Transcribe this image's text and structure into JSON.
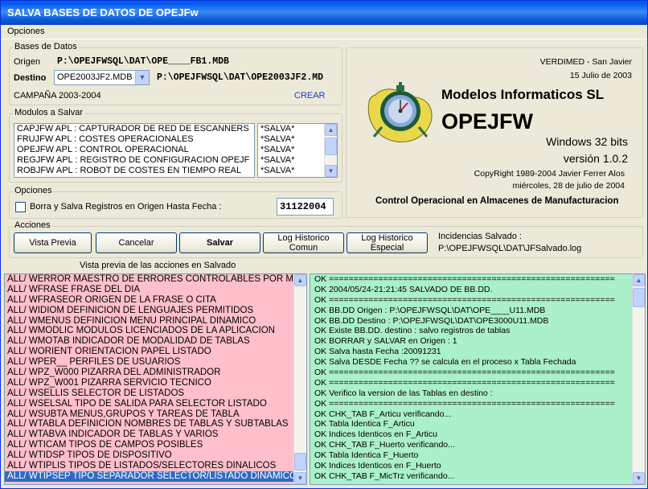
{
  "window": {
    "title": "SALVA BASES DE DATOS DE OPEJFw"
  },
  "menu": {
    "opciones": "Opciones"
  },
  "bases": {
    "label": "Bases de Datos",
    "origen_label": "Origen",
    "origen_path": "P:\\OPEJFWSQL\\DAT\\OPE____FB1.MDB",
    "destino_label": "Destino",
    "destino_combo": "OPE2003JF2.MDB",
    "destino_path": "P:\\OPEJFWSQL\\DAT\\OPE2003JF2.MD",
    "campana": "CAMPAÑA 2003-2004",
    "crear": "CREAR"
  },
  "modulos": {
    "label": "Modulos a Salvar",
    "items": [
      "CAPJFW APL : CAPTURADOR DE RED DE ESCANNERS",
      "FRUJFW APL : COSTES OPERACIONALES",
      "OPEJFW APL : CONTROL OPERACIONAL",
      "REGJFW APL : REGISTRO DE CONFIGURACION OPEJF",
      "ROBJFW APL : ROBOT DE COSTES EN TIEMPO REAL"
    ],
    "status": [
      "*SALVA*",
      "*SALVA*",
      "*SALVA*",
      "*SALVA*",
      "*SALVA*"
    ]
  },
  "opciones": {
    "label": "Opciones",
    "checkbox_label": "Borra y Salva Registros en Origen Hasta Fecha :",
    "fecha": "31122004"
  },
  "info": {
    "company_top": "VERDIMED - San Javier",
    "date_top": "15 Julio de 2003",
    "company": "Modelos Informaticos SL",
    "product": "OPEJFW",
    "platform": "Windows 32 bits",
    "version": "versión 1.0.2",
    "copyright": "CopyRight 1989-2004 Javier Ferrer Alos",
    "today": "miércoles, 28 de julio de 2004",
    "description": "Control Operacional en Almacenes de Manufacturacion"
  },
  "acciones": {
    "label": "Acciones",
    "buttons": {
      "vista_previa": "Vista Previa",
      "cancelar": "Cancelar",
      "salvar": "Salvar",
      "log_comun_1": "Log Historico",
      "log_comun_2": "Comun",
      "log_especial_1": "Log Historico",
      "log_especial_2": "Especial"
    },
    "incidencias_label": "Incidencias Salvado :",
    "incidencias_path": "P:\\OPEJFWSQL\\DAT\\JFSalvado.log"
  },
  "preview": {
    "caption": "Vista previa de las acciones en Salvado",
    "rows": [
      "ALL/ WERROR MAESTRO DE ERRORES CONTROLABLES POR MDB",
      "ALL/ WFRASE FRASE DEL DIA",
      "ALL/ WFRASEOR ORIGEN DE LA FRASE O CITA",
      "ALL/ WIDIOM DEFINICION DE LENGUAJES PERMITIDOS",
      "ALL/ WMENUS DEFINICION MENU PRINCIPAL DINAMICO",
      "ALL/ WMODLIC MODULOS LICENCIADOS DE LA APLICACION",
      "ALL/ WMOTAB INDICADOR DE MODALIDAD DE TABLAS",
      "ALL/ WORIENT ORIENTACION PAPEL LISTADO",
      "ALL/ WPER__ PERFILES DE USUARIOS",
      "ALL/ WPZ_W000 PIZARRA DEL ADMINISTRADOR",
      "ALL/ WPZ_W001 PIZARRA SERVICIO TECNICO",
      "ALL/ WSELLIS SELECTOR DE LISTADOS",
      "ALL/ WSELSAL TIPO DE SALIDA PARA SELECTOR LISTADO",
      "ALL/ WSUBTA MENUS,GRUPOS Y TAREAS DE TABLA",
      "ALL/ WTABLA DEFINICION NOMBRES DE TABLAS Y SUBTABLAS",
      "ALL/ WTABVA INDICADOR DE TABLAS Y VARIOS",
      "ALL/ WTICAM TIPOS DE CAMPOS POSIBLES",
      "ALL/ WTIDSP TIPOS DE DISPOSITIVO",
      "ALL/ WTIPLIS TIPOS DE LISTADOS/SELECTORES DINALICOS",
      "ALL/ WTIPSEP TIPO SEPARADOR SELECTOR/LISTADO DINAMICO"
    ]
  },
  "log": {
    "rows": [
      "OK ==========================================================",
      "OK 2004/05/24-21:21:45          SALVADO DE BB.DD.",
      "OK ==========================================================",
      "OK BB.DD Origen : P:\\OPEJFWSQL\\DAT\\OPE____U11.MDB",
      "OK BB.DD Destino : P:\\OPEJFWSQL\\DAT\\OPE3000U11.MDB",
      "OK Existe BB.DD. destino : salvo registros de tablas",
      "OK BORRAR y SALVAR en Origen : 1",
      "OK Salva hasta Fecha :20091231",
      "OK Salva DESDE Fecha ?? se calcula en el proceso x Tabla Fechada",
      "OK ==========================================================",
      "OK ==========================================================",
      "OK Verifico la version de las Tablas en destino :",
      "OK ==========================================================",
      "OK CHK_TAB  F_Articu verificando...",
      "OK Tabla Identica F_Articu",
      "OK Indices Identicos en F_Articu",
      "OK CHK_TAB  F_Huerto verificando...",
      "OK Tabla Identica F_Huerto",
      "OK Indices Identicos en F_Huerto",
      "OK CHK_TAB  F_MicTrz verificando..."
    ]
  },
  "colors": {
    "preview_bg": "#ffc0cb",
    "log_bg": "#aaf0c8",
    "selection": "#316ac5"
  },
  "icons": {
    "logo": "stopwatch-logo-icon",
    "scroll_up": "arrow-up-icon",
    "scroll_down": "arrow-down-icon",
    "combo": "chevron-down-icon"
  }
}
